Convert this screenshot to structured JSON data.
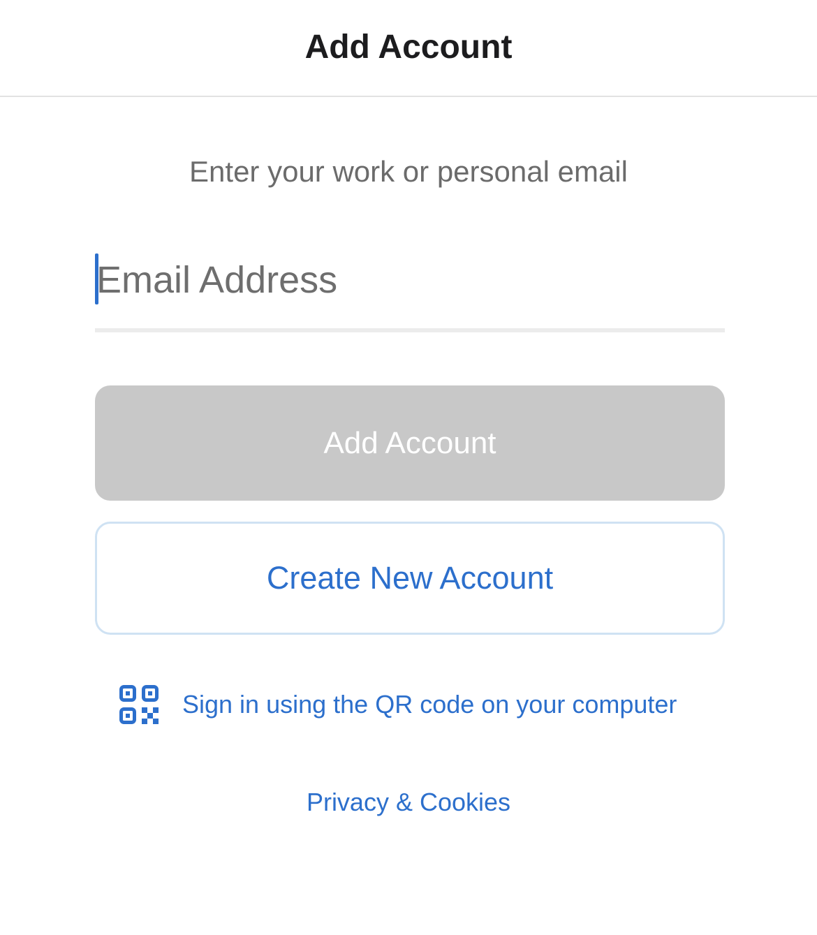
{
  "nav": {
    "title": "Add Account"
  },
  "prompt": "Enter your work or personal email",
  "email": {
    "value": "",
    "placeholder": "Email Address"
  },
  "buttons": {
    "add_account": "Add Account",
    "create_account": "Create New Account"
  },
  "qr": {
    "icon": "qr-code-icon",
    "label": "Sign in using the QR code on your computer"
  },
  "footer": {
    "privacy_link": "Privacy & Cookies"
  },
  "colors": {
    "accent": "#2c6fcc",
    "disabled_button": "#c8c8c8",
    "outline_border": "#cfe2f3",
    "prompt_text": "#6b6b6b",
    "title_text": "#1c1c1e"
  }
}
